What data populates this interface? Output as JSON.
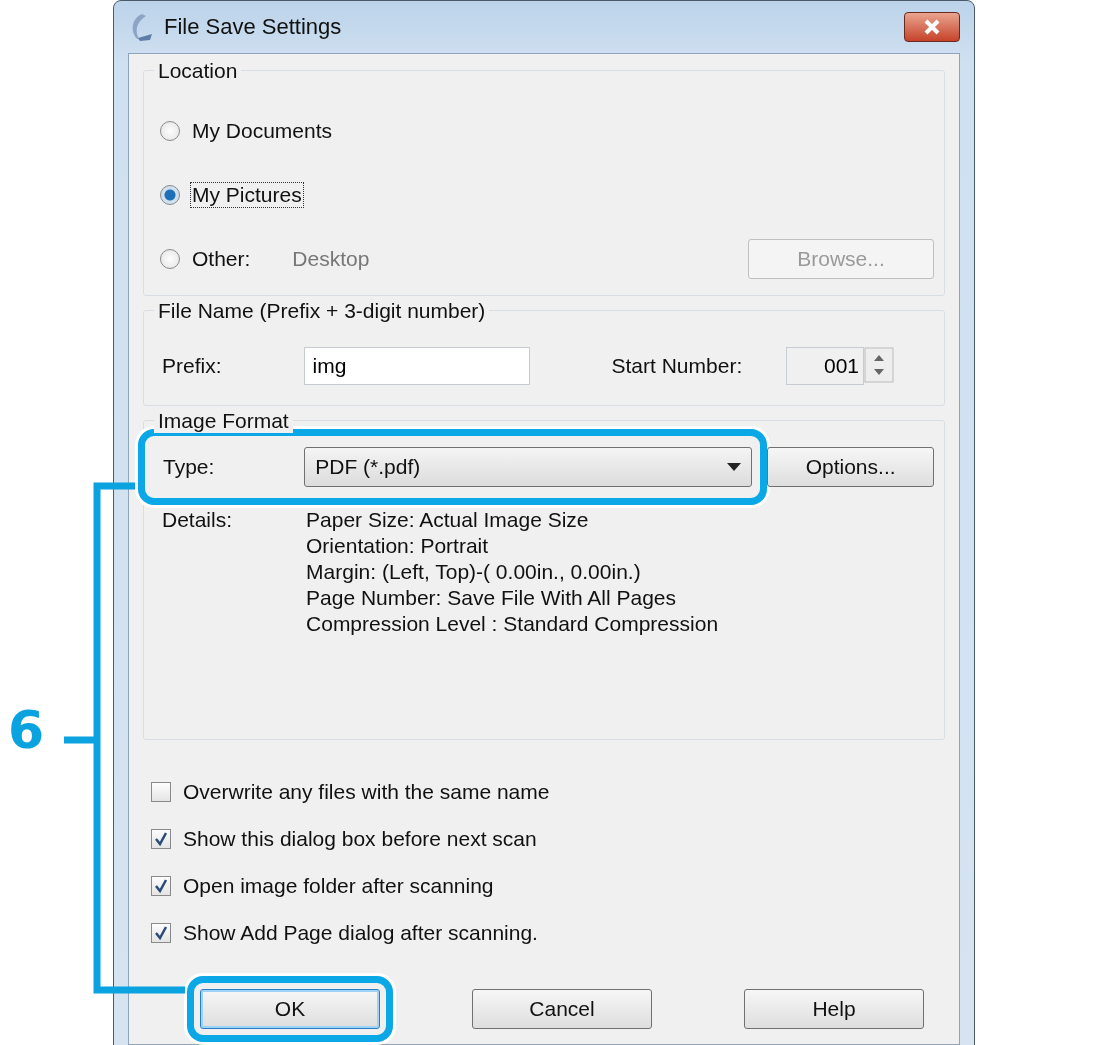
{
  "window": {
    "title": "File Save Settings"
  },
  "location": {
    "legend": "Location",
    "options": [
      {
        "label": "My Documents",
        "selected": false,
        "focused": false
      },
      {
        "label": "My Pictures",
        "selected": true,
        "focused": true
      },
      {
        "label": "Other:",
        "selected": false,
        "focused": false,
        "value": "Desktop"
      }
    ],
    "browse": {
      "label": "Browse...",
      "disabled": true
    }
  },
  "file_name": {
    "legend": "File Name (Prefix + 3-digit number)",
    "prefix_label": "Prefix:",
    "prefix_value": "img",
    "start_label": "Start Number:",
    "start_value": "001"
  },
  "image_format": {
    "legend": "Image Format",
    "type_label": "Type:",
    "type_value": "PDF (*.pdf)",
    "type_highlighted": true,
    "options_button": "Options...",
    "details_label": "Details:",
    "details": [
      "Paper Size: Actual Image Size",
      "Orientation: Portrait",
      "Margin: (Left, Top)-( 0.00in., 0.00in.)",
      "Page Number: Save File With All Pages",
      "Compression Level : Standard Compression"
    ]
  },
  "checkboxes": [
    {
      "label": "Overwrite any files with the same name",
      "checked": false
    },
    {
      "label": "Show this dialog box before next scan",
      "checked": true
    },
    {
      "label": "Open image folder after scanning",
      "checked": true
    },
    {
      "label": "Show Add Page dialog after scanning.",
      "checked": true
    }
  ],
  "buttons": [
    {
      "label": "OK",
      "default": true,
      "highlighted": true
    },
    {
      "label": "Cancel",
      "default": false,
      "highlighted": false
    },
    {
      "label": "Help",
      "default": false,
      "highlighted": false
    }
  ],
  "annotation": {
    "step": "6"
  }
}
